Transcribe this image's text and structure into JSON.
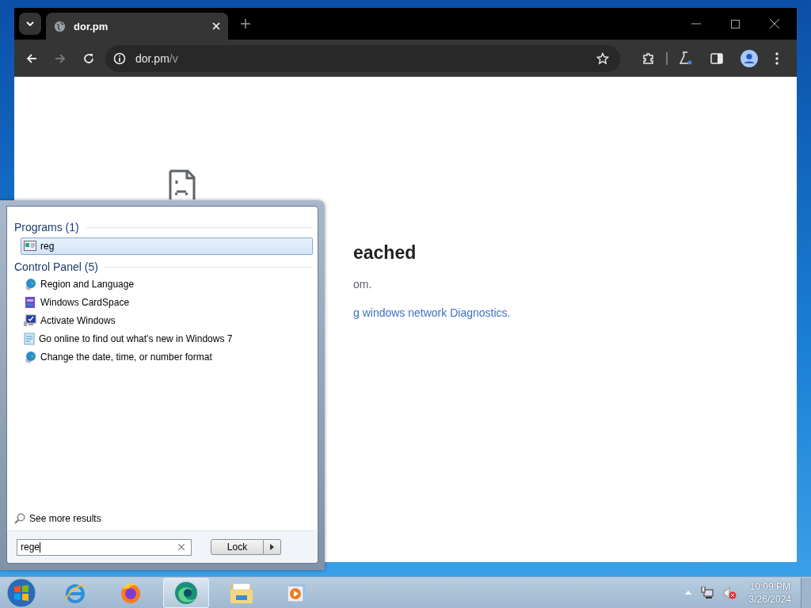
{
  "browser": {
    "tab": {
      "title": "dor.pm"
    },
    "address": {
      "host": "dor.pm",
      "path": "/v"
    },
    "page": {
      "heading": "eached",
      "line": "om.",
      "link": "g windows network Diagnostics."
    }
  },
  "start_menu": {
    "groups": [
      {
        "title": "Programs (1)",
        "items": [
          {
            "label": "reg",
            "kind": "window",
            "selected": true
          }
        ]
      },
      {
        "title": "Control Panel (5)",
        "items": [
          {
            "label": "Region and Language",
            "kind": "globe",
            "selected": false
          },
          {
            "label": "Windows CardSpace",
            "kind": "card",
            "selected": false
          },
          {
            "label": "Activate Windows",
            "kind": "monitor",
            "selected": false
          },
          {
            "label": "Go online to find out what's new in Windows 7",
            "kind": "document",
            "selected": false
          },
          {
            "label": "Change the date, time, or number format",
            "kind": "globe",
            "selected": false
          }
        ]
      }
    ],
    "see_more": "See more results",
    "search": {
      "value": "rege"
    },
    "power_button": "Lock"
  },
  "taskbar": {
    "apps": [
      {
        "kind": "ie",
        "selected": false
      },
      {
        "kind": "firefox",
        "selected": false
      },
      {
        "kind": "edge",
        "selected": true
      },
      {
        "kind": "explorer",
        "selected": false
      },
      {
        "kind": "media",
        "selected": false
      }
    ],
    "clock": {
      "time": "10:09 PM",
      "date": "3/26/2024"
    }
  }
}
